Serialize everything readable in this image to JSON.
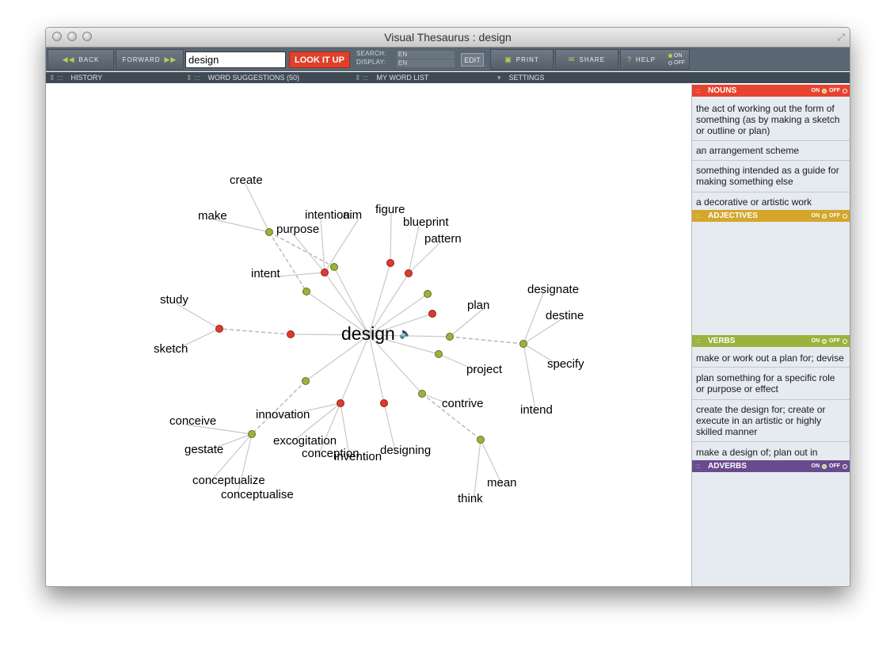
{
  "window": {
    "title": "Visual Thesaurus : design"
  },
  "toolbar": {
    "back_label": "BACK",
    "forward_label": "FORWARD",
    "search_value": "design",
    "lookup_label": "LOOK IT UP",
    "search_label": "SEARCH:",
    "display_label": "DISPLAY:",
    "search_lang": "EN",
    "display_lang": "EN",
    "edit_label": "EDIT",
    "print_label": "PRINT",
    "share_label": "SHARE",
    "help_label": "HELP",
    "on_label": "ON",
    "off_label": "OFF"
  },
  "subbar": {
    "history_label": "HISTORY",
    "suggestions_label": "WORD SUGGESTIONS (50)",
    "wordlist_label": "MY WORD LIST",
    "settings_label": "SETTINGS"
  },
  "graph": {
    "center_word": "design",
    "words": {
      "create": "create",
      "make": "make",
      "intention": "intention",
      "aim": "aim",
      "purpose": "purpose",
      "intent": "intent",
      "figure": "figure",
      "blueprint": "blueprint",
      "pattern": "pattern",
      "study": "study",
      "sketch": "sketch",
      "designate": "designate",
      "destine": "destine",
      "plan": "plan",
      "specify": "specify",
      "project": "project",
      "intend": "intend",
      "contrive": "contrive",
      "conceive": "conceive",
      "innovation": "innovation",
      "excogitation": "excogitation",
      "conception": "conception",
      "invention": "invention",
      "designing": "designing",
      "gestate": "gestate",
      "conceptualize": "conceptualize",
      "conceptualise": "conceptualise",
      "mean": "mean",
      "think": "think"
    },
    "node_colors": {
      "noun": "#dd3b2b",
      "verb": "#9bb33e"
    }
  },
  "sidepanel": {
    "nouns": {
      "label": "NOUNS",
      "color": "#e8432e",
      "definitions": [
        "the act of working out the form of something (as by making a sketch or outline or plan)",
        "an arrangement scheme",
        "something intended as a guide for making something else",
        "a decorative or artistic work"
      ]
    },
    "adjectives": {
      "label": "ADJECTIVES",
      "color": "#d4a72c"
    },
    "verbs": {
      "label": "VERBS",
      "color": "#9bb33e",
      "definitions": [
        "make or work out a plan for; devise",
        "plan something for a specific role or purpose or effect",
        "create the design for; create or execute in an artistic or highly skilled manner",
        "make a design of; plan out in"
      ]
    },
    "adverbs": {
      "label": "ADVERBS",
      "color": "#6a4a8e"
    },
    "on_label": "ON",
    "off_label": "OFF"
  }
}
